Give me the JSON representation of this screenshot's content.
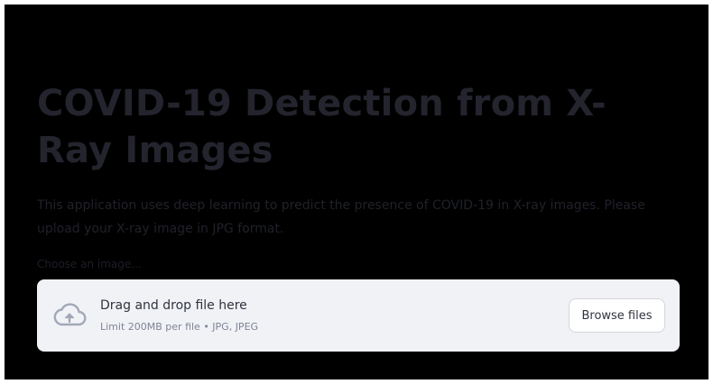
{
  "page": {
    "title": "COVID-19 Detection from X-Ray Images",
    "description": "This application uses deep learning to predict the presence of COVID-19 in X-ray images. Please upload your X-ray image in JPG format."
  },
  "uploader": {
    "label": "Choose an image...",
    "drop_text": "Drag and drop file here",
    "limit_text": "Limit 200MB per file • JPG, JPEG",
    "browse_label": "Browse files",
    "icon": "cloud-upload-icon"
  },
  "colors": {
    "background": "#000000",
    "dropzone": "#f0f2f6",
    "icon": "#a3a8b8"
  }
}
